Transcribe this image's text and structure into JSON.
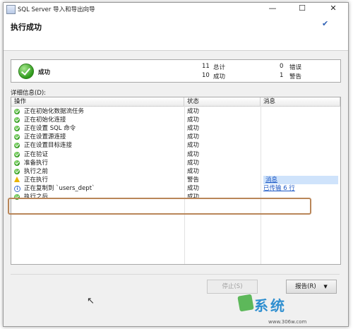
{
  "window": {
    "title": "SQL Server 导入和导出向导",
    "minimize": "—",
    "maximize": "☐",
    "close": "✕"
  },
  "header": {
    "title": "执行成功",
    "check_glyph": "✔"
  },
  "status": {
    "label": "成功",
    "total_count": "11",
    "total_label": "总计",
    "success_count": "10",
    "success_label": "成功",
    "error_count": "0",
    "error_label": "错误",
    "warning_count": "1",
    "warning_label": "警告"
  },
  "details": {
    "label": "详细信息(D):",
    "columns": [
      "操作",
      "状态",
      "消息"
    ],
    "rows": [
      {
        "icon": "success-icon",
        "op": "正在初始化数据流任务",
        "status": "成功",
        "msg": ""
      },
      {
        "icon": "success-icon",
        "op": "正在初始化连接",
        "status": "成功",
        "msg": ""
      },
      {
        "icon": "success-icon",
        "op": "正在设置 SQL 命令",
        "status": "成功",
        "msg": ""
      },
      {
        "icon": "success-icon",
        "op": "正在设置源连接",
        "status": "成功",
        "msg": ""
      },
      {
        "icon": "success-icon",
        "op": "正在设置目标连接",
        "status": "成功",
        "msg": ""
      },
      {
        "icon": "success-icon",
        "op": "正在验证",
        "status": "成功",
        "msg": ""
      },
      {
        "icon": "success-icon",
        "op": "准备执行",
        "status": "成功",
        "msg": ""
      },
      {
        "icon": "success-icon",
        "op": "执行之前",
        "status": "成功",
        "msg": ""
      },
      {
        "icon": "warning-icon",
        "op": "正在执行",
        "status": "警告",
        "msg": "消息"
      },
      {
        "icon": "info-icon",
        "op": "正在复制到 `users_dept`",
        "status": "成功",
        "msg": "已传输 6 行"
      },
      {
        "icon": "success-icon",
        "op": "执行之后",
        "status": "成功",
        "msg": ""
      }
    ]
  },
  "buttons": {
    "stop": "停止(S)",
    "report": "报告(R)",
    "report_arrow": "▼"
  },
  "watermark": {
    "text": "系统",
    "url": "www.306w.com"
  }
}
